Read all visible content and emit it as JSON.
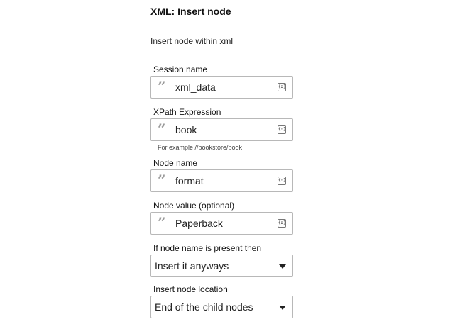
{
  "panel": {
    "title": "XML: Insert node",
    "description": "Insert node within xml"
  },
  "fields": {
    "session_name": {
      "label": "Session name",
      "value": "xml_data",
      "quote_icon": "quote-icon",
      "variable_icon": "variable-icon",
      "variable_glyph": "{x}"
    },
    "xpath": {
      "label": "XPath Expression",
      "value": "book",
      "hint": "For example //bookstore/book",
      "quote_icon": "quote-icon",
      "variable_icon": "variable-icon",
      "variable_glyph": "{x}"
    },
    "node_name": {
      "label": "Node name",
      "value": "format",
      "quote_icon": "quote-icon",
      "variable_icon": "variable-icon",
      "variable_glyph": "{x}"
    },
    "node_value": {
      "label": "Node value (optional)",
      "value": "Paperback",
      "quote_icon": "quote-icon",
      "variable_icon": "variable-icon",
      "variable_glyph": "{x}"
    },
    "if_present": {
      "label": "If node name is present then",
      "selected": "Insert it anyways",
      "caret_icon": "chevron-down-icon"
    },
    "location": {
      "label": "Insert node location",
      "selected": "End of the child nodes",
      "caret_icon": "chevron-down-icon"
    }
  }
}
